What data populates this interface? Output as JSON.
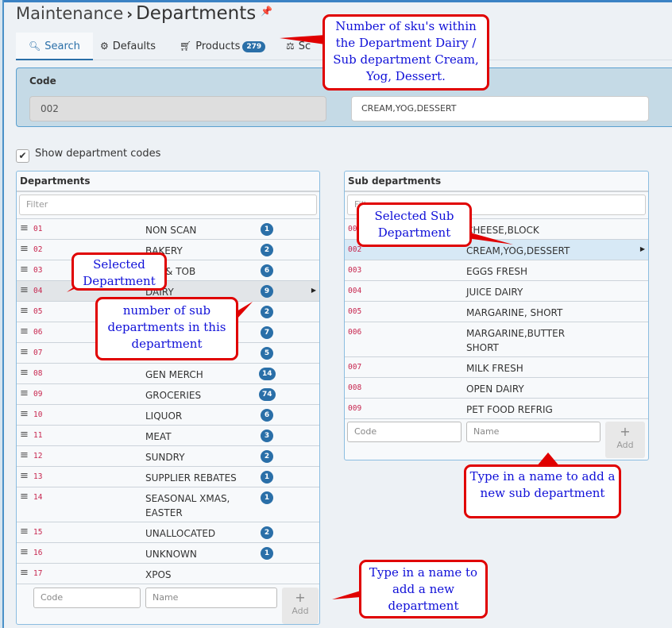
{
  "header": {
    "breadcrumb_parent": "Maintenance",
    "separator": "›",
    "title": "Departments",
    "pin_icon": "pin-icon"
  },
  "tabs": [
    {
      "label": "Search",
      "icon": "search-icon",
      "active": true
    },
    {
      "label": "Defaults",
      "icon": "gear-icon",
      "active": false
    },
    {
      "label": "Products",
      "icon": "cart-icon",
      "badge": "279",
      "active": false
    },
    {
      "label": "Sc",
      "icon": "scale-icon",
      "active": false
    }
  ],
  "code_panel": {
    "label": "Code",
    "code_value": "002",
    "name_value": "CREAM,YOG,DESSERT"
  },
  "show_codes": {
    "label": "Show department codes",
    "checked": true
  },
  "departments": {
    "title": "Departments",
    "filter_placeholder": "Filter",
    "rows": [
      {
        "code": "01",
        "name": "NON SCAN",
        "count": "1"
      },
      {
        "code": "02",
        "name": "BAKERY",
        "count": "2"
      },
      {
        "code": "03",
        "name": "CIG & TOB",
        "count": "6"
      },
      {
        "code": "04",
        "name": "DAIRY",
        "count": "9",
        "selected": true
      },
      {
        "code": "05",
        "name": "",
        "count": "2"
      },
      {
        "code": "06",
        "name": "",
        "count": "7"
      },
      {
        "code": "07",
        "name": "",
        "count": "5"
      },
      {
        "code": "08",
        "name": "GEN MERCH",
        "count": "14"
      },
      {
        "code": "09",
        "name": "GROCERIES",
        "count": "74"
      },
      {
        "code": "10",
        "name": "LIQUOR",
        "count": "6"
      },
      {
        "code": "11",
        "name": "MEAT",
        "count": "3"
      },
      {
        "code": "12",
        "name": "SUNDRY",
        "count": "2"
      },
      {
        "code": "13",
        "name": "SUPPLIER REBATES",
        "count": "1"
      },
      {
        "code": "14",
        "name": "SEASONAL XMAS, EASTER",
        "count": "1"
      },
      {
        "code": "15",
        "name": "UNALLOCATED",
        "count": "2"
      },
      {
        "code": "16",
        "name": "UNKNOWN",
        "count": "1"
      },
      {
        "code": "17",
        "name": "XPOS",
        "count": ""
      }
    ],
    "add_code_placeholder": "Code",
    "add_name_placeholder": "Name",
    "add_plus": "+",
    "add_label": "Add"
  },
  "sub_departments": {
    "title": "Sub departments",
    "filter_placeholder": "Filter",
    "rows": [
      {
        "code": "001",
        "name": "CHEESE,BLOCK"
      },
      {
        "code": "002",
        "name": "CREAM,YOG,DESSERT",
        "selected": true
      },
      {
        "code": "003",
        "name": "EGGS FRESH"
      },
      {
        "code": "004",
        "name": "JUICE DAIRY"
      },
      {
        "code": "005",
        "name": "MARGARINE, SHORT"
      },
      {
        "code": "006",
        "name": "MARGARINE,BUTTER SHORT"
      },
      {
        "code": "007",
        "name": "MILK FRESH"
      },
      {
        "code": "008",
        "name": "OPEN DAIRY"
      },
      {
        "code": "009",
        "name": "PET FOOD REFRIG"
      }
    ],
    "add_code_placeholder": "Code",
    "add_name_placeholder": "Name",
    "add_plus": "+",
    "add_label": "Add"
  },
  "callouts": {
    "sku_count": "Number of sku's within the Department Dairy / Sub department Cream, Yog, Dessert.",
    "selected_department": "Selected Department",
    "sub_dept_count": "number of sub departments in this department",
    "selected_sub_department": "Selected Sub Department",
    "add_sub_department": "Type in a name to add a new sub department",
    "add_department": "Type in a name to add a new department"
  },
  "colors": {
    "accent": "#2a6fa8",
    "code_text": "#c7254e",
    "callout_border": "#e00000",
    "callout_text": "#1010d8"
  }
}
